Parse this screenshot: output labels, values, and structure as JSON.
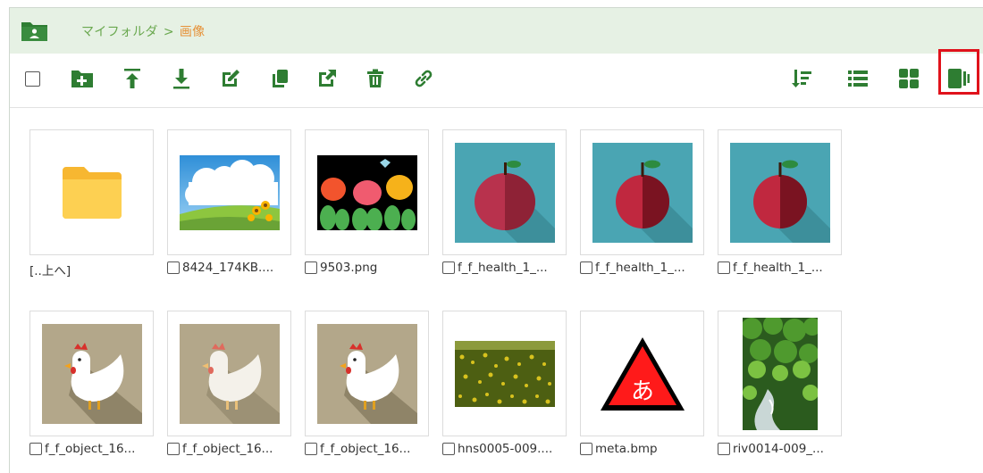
{
  "header": {
    "breadcrumb_root": "マイフォルダ",
    "breadcrumb_sep": ">",
    "breadcrumb_current": "画像"
  },
  "toolbar": {
    "icons": [
      "checkbox-select-all",
      "new-folder-icon",
      "upload-icon",
      "download-icon",
      "edit-icon",
      "copy-icon",
      "open-external-icon",
      "delete-icon",
      "link-icon",
      "sort-icon",
      "list-view-icon",
      "tile-view-icon",
      "thumbnail-view-icon"
    ],
    "active_view": "thumbnail-view-icon"
  },
  "files": [
    {
      "caption": "[..上へ]",
      "checkbox": false,
      "kind": "parent-folder"
    },
    {
      "caption": "8424_174KB....",
      "checkbox": true,
      "kind": "landscape"
    },
    {
      "caption": "9503.png",
      "checkbox": true,
      "kind": "tulips"
    },
    {
      "caption": "f_f_health_1_...",
      "checkbox": true,
      "kind": "apple-blurred"
    },
    {
      "caption": "f_f_health_1_...",
      "checkbox": true,
      "kind": "apple"
    },
    {
      "caption": "f_f_health_1_...",
      "checkbox": true,
      "kind": "apple"
    },
    {
      "caption": "f_f_object_16...",
      "checkbox": true,
      "kind": "chicken"
    },
    {
      "caption": "f_f_object_16...",
      "checkbox": true,
      "kind": "chicken-blurred"
    },
    {
      "caption": "f_f_object_16...",
      "checkbox": true,
      "kind": "chicken"
    },
    {
      "caption": "hns0005-009....",
      "checkbox": true,
      "kind": "flower-field"
    },
    {
      "caption": "meta.bmp",
      "checkbox": true,
      "kind": "warning-a",
      "glyph": "あ"
    },
    {
      "caption": "riv0014-009_...",
      "checkbox": true,
      "kind": "river"
    }
  ],
  "colors": {
    "accent": "#2e7d32",
    "header_bg": "#e6f1e4",
    "breadcrumb_link": "#6aa84f",
    "breadcrumb_current": "#e69138",
    "active_border": "#e0121b"
  }
}
